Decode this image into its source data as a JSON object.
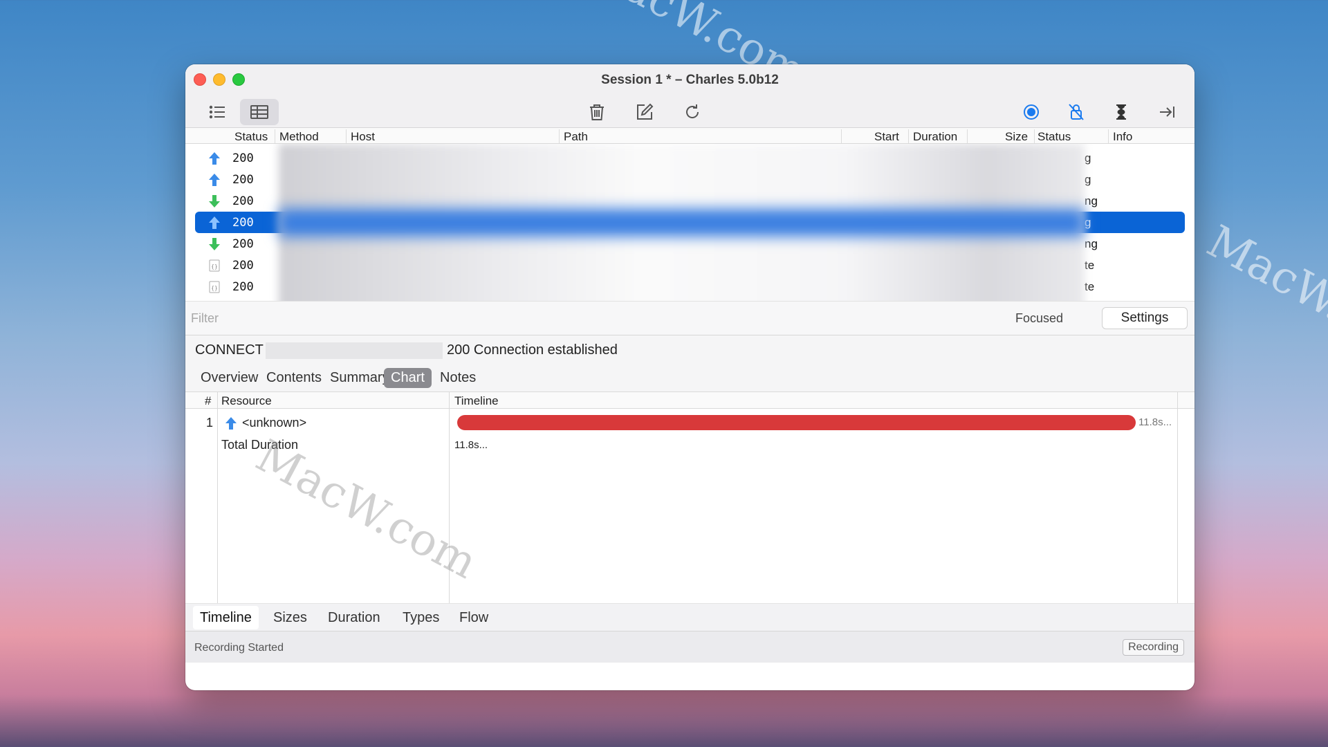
{
  "watermarks": [
    "MacW.com",
    "MacW.com",
    "MacW.com"
  ],
  "window": {
    "title": "Session 1 * – Charles 5.0b12"
  },
  "toolbar": {
    "view_structure": "list-icon",
    "view_sequence": "table-icon",
    "clear": "trash-icon",
    "edit": "compose-icon",
    "repeat": "refresh-icon",
    "record": "record-icon",
    "ssl_proxy": "lock-slash-icon",
    "throttle": "hourglass-icon",
    "breakpoints": "arrow-right-icon"
  },
  "table": {
    "columns": [
      "Status",
      "Method",
      "Host",
      "Path",
      "Start",
      "Duration",
      "Size",
      "Status",
      "Info"
    ],
    "rows": [
      {
        "icon": "upload-arrow-icon",
        "status": "200",
        "tail": "g"
      },
      {
        "icon": "upload-arrow-icon",
        "status": "200",
        "tail": "g"
      },
      {
        "icon": "download-arrow-icon",
        "status": "200",
        "tail": "ng"
      },
      {
        "icon": "upload-arrow-icon",
        "status": "200",
        "tail": "g",
        "selected": true
      },
      {
        "icon": "download-arrow-icon",
        "status": "200",
        "tail": "ng"
      },
      {
        "icon": "json-doc-icon",
        "status": "200",
        "tail": "te"
      },
      {
        "icon": "json-doc-icon",
        "status": "200",
        "tail": "te"
      }
    ]
  },
  "filter": {
    "placeholder": "Filter",
    "focused_label": "Focused",
    "settings_label": "Settings"
  },
  "detail": {
    "method": "CONNECT",
    "message": "200 Connection established"
  },
  "tabs": [
    "Overview",
    "Contents",
    "Summary",
    "Chart",
    "Notes"
  ],
  "chart_tab_active": "Chart",
  "chart": {
    "headers": {
      "num": "#",
      "resource": "Resource",
      "timeline": "Timeline"
    },
    "rows": [
      {
        "num": "1",
        "icon": "upload-arrow-icon",
        "resource": "<unknown>",
        "label": "11.8s..."
      }
    ],
    "total_label": "Total Duration",
    "total_value": "11.8s..."
  },
  "chart_data": {
    "type": "bar",
    "categories": [
      "<unknown>"
    ],
    "values": [
      11.8
    ],
    "title": "",
    "xlabel": "",
    "ylabel": "",
    "color": "#d8393a"
  },
  "bottom_tabs": [
    "Timeline",
    "Sizes",
    "Duration",
    "Types",
    "Flow"
  ],
  "status": {
    "left": "Recording Started",
    "right": "Recording"
  }
}
